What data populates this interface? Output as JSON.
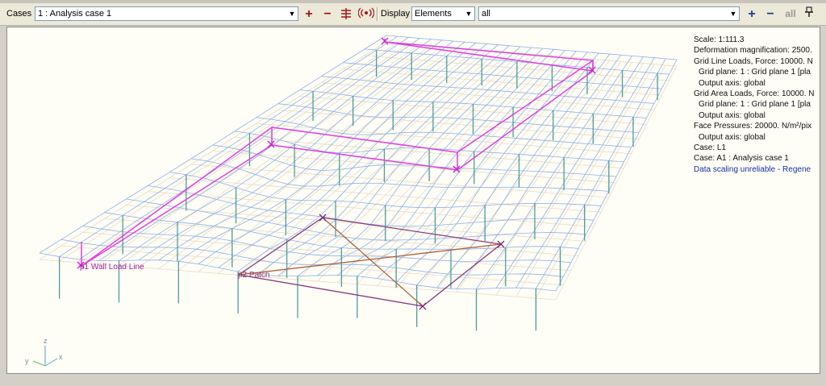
{
  "toolbar": {
    "cases_label": "Cases",
    "case_value": "1 : Analysis case 1",
    "add_label": "+",
    "remove_label": "−",
    "display_label": "Display",
    "display_value": "Elements",
    "filter_value": "all",
    "all_label": "all",
    "add2_label": "+",
    "remove2_label": "−"
  },
  "viewport": {
    "legend": [
      "Scale: 1:111.3",
      "Deformation magnification: 2500.",
      "Grid Line Loads, Force: 10000. N",
      "Grid plane: 1 : Grid plane 1 [pla",
      "Output axis: global",
      "Grid Area Loads, Force: 10000. N",
      "Grid plane: 1 : Grid plane 1 [pla",
      "Output axis: global",
      "Face Pressures: 20000. N/m²/pix",
      "Output axis: global",
      "Case: L1",
      "Case: A1 : Analysis case 1",
      "Data scaling unreliable - Regene"
    ],
    "load_labels": {
      "line_load": "p1 Wall Load Line",
      "patch": "p2 Patch"
    },
    "axes": {
      "z": "z",
      "y": "y",
      "x": "x"
    }
  },
  "colors": {
    "mesh_deformed": "#8fb1e8",
    "mesh_undeformed": "#e8dcc6",
    "columns": "#4e9c9a",
    "line_load": "#e040e0",
    "patch": "#8a3c7a",
    "warning_text": "#1b2fa8",
    "toolbar_red": "#a31515"
  }
}
